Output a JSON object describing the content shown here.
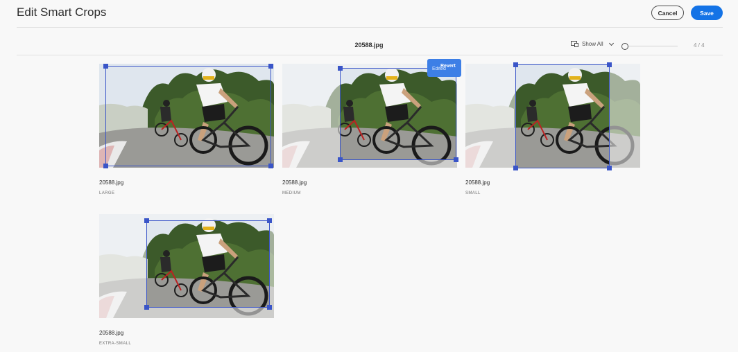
{
  "header": {
    "title": "Edit Smart Crops",
    "cancel_label": "Cancel",
    "save_label": "Save"
  },
  "toolbar": {
    "filename": "20588.jpg",
    "view_label": "Show All",
    "page_count": "4 / 4"
  },
  "cards": [
    {
      "filename": "20588.jpg",
      "size_label": "LARGE",
      "edited": false
    },
    {
      "filename": "20588.jpg",
      "size_label": "MEDIUM",
      "edited": true,
      "edited_label": "Edited",
      "revert_label": "Revert"
    },
    {
      "filename": "20588.jpg",
      "size_label": "SMALL",
      "edited": false
    },
    {
      "filename": "20588.jpg",
      "size_label": "EXTRA-SMALL",
      "edited": false
    }
  ],
  "colors": {
    "accent": "#1473e6",
    "crop_border": "#3a55c8",
    "badge": "#3d7fe6",
    "background": "#f8f8f8"
  }
}
